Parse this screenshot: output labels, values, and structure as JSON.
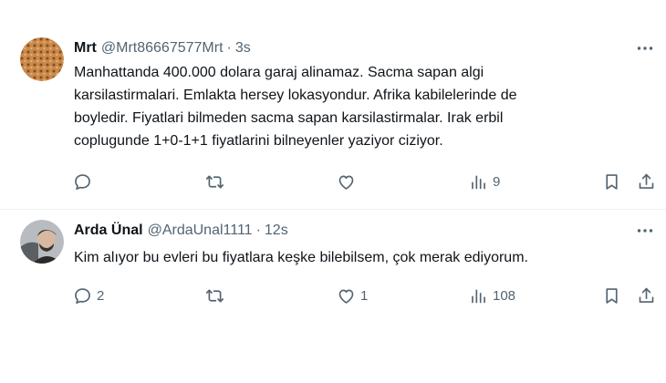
{
  "tweets": [
    {
      "name": "Mrt",
      "handle": "@Mrt86667577Mrt",
      "separator": "·",
      "time": "3s",
      "text_lines": [
        "Manhattanda 400.000 dolara garaj alinamaz. Sacma sapan algi",
        "karsilastirmalari. Emlakta hersey lokasyondur. Afrika kabilelerinde de",
        "boyledir. Fiyatlari bilmeden sacma sapan karsilastirmalar. Irak erbil",
        "coplugunde 1+0-1+1 fiyatlarini bilneyenler yaziyor ciziyor."
      ],
      "reply_count": "",
      "retweet_count": "",
      "like_count": "",
      "view_count": "9"
    },
    {
      "name": "Arda Ünal",
      "handle": "@ArdaUnal1111",
      "separator": "·",
      "time": "12s",
      "text_lines": [
        "Kim alıyor bu evleri bu fiyatlara keşke bilebilsem, çok merak ediyorum."
      ],
      "reply_count": "2",
      "retweet_count": "",
      "like_count": "1",
      "view_count": "108"
    }
  ],
  "icons": {
    "reply": "reply-icon",
    "retweet": "retweet-icon",
    "like": "heart-icon",
    "views": "views-icon",
    "bookmark": "bookmark-icon",
    "share": "share-icon",
    "more": "more-icon"
  },
  "colors": {
    "text_primary": "#0f1419",
    "text_secondary": "#536471",
    "divider": "#eff3f4"
  }
}
